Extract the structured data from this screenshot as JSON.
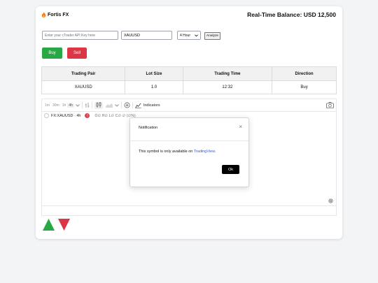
{
  "header": {
    "brand": "Fortis FX",
    "balance": "Real-Time Balance: USD 12,500"
  },
  "form": {
    "api_placeholder": "Enter your cTrader API Key here",
    "api_value": "",
    "symbol_value": "XAUUSD",
    "timeframe": "4 Hour",
    "analyze_label": "Analyze"
  },
  "actions": {
    "buy_label": "Buy",
    "sell_label": "Sell"
  },
  "table": {
    "headers": [
      "Trading Pair",
      "Lot Size",
      "Trading Time",
      "Direction"
    ],
    "rows": [
      [
        "XAUUSD",
        "1.0",
        "12:32",
        "Buy"
      ]
    ]
  },
  "chart_toolbar": {
    "intervals": [
      "1m",
      "30m",
      "1h",
      "4h"
    ],
    "indicators_label": "Indicators"
  },
  "chart_legend": {
    "symbol": "FX:XAUUSD · 4h",
    "badge": "!",
    "ohlc": "O∅ H∅ L∅ C∅ ∅ (∅%)"
  },
  "modal": {
    "title": "Notification",
    "message_prefix": "This symbol is only available on ",
    "message_link": "TradingView",
    "message_suffix": ".",
    "ok_label": "Ok"
  },
  "colors": {
    "buy": "#28a745",
    "sell": "#dc3545",
    "up_arrow": "#28a745",
    "down_arrow": "#dc3545",
    "link": "#2563eb"
  },
  "icons": [
    "fire-icon",
    "camera-icon",
    "settings-icon",
    "close-icon",
    "plus-circle-icon",
    "indicators-icon",
    "up-triangle-icon",
    "down-triangle-icon"
  ]
}
